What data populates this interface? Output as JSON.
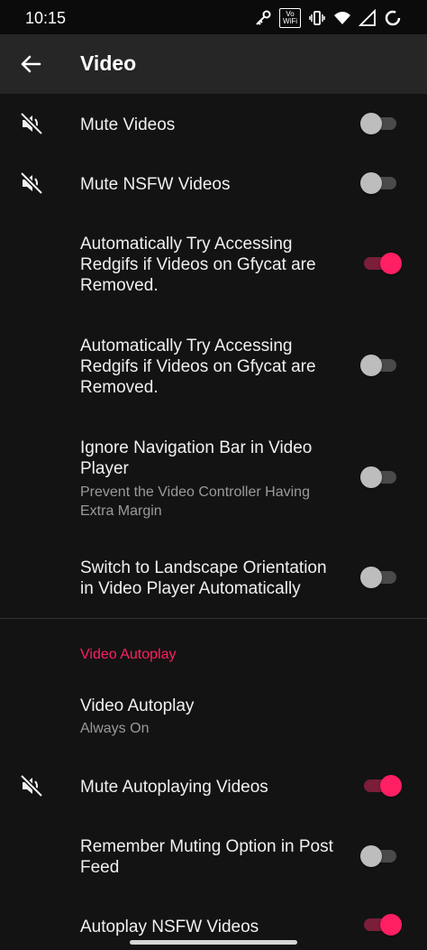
{
  "status": {
    "time": "10:15",
    "volte_top": "Vo",
    "volte_bottom": "WiFi"
  },
  "appbar": {
    "title": "Video"
  },
  "items": [
    {
      "label": "Mute Videos",
      "on": false
    },
    {
      "label": "Mute NSFW Videos",
      "on": false
    },
    {
      "label": "Automatically Try Accessing Redgifs if Videos on Gfycat are Removed.",
      "on": true
    },
    {
      "label": "Automatically Try Accessing Redgifs if Videos on Gfycat are Removed.",
      "on": false
    },
    {
      "label": "Ignore Navigation Bar in Video Player",
      "sublabel": "Prevent the Video Controller Having Extra Margin",
      "on": false
    },
    {
      "label": "Switch to Landscape Orientation in Video Player Automatically",
      "on": false
    }
  ],
  "autoplay_section": {
    "header": "Video Autoplay",
    "video_autoplay": {
      "label": "Video Autoplay",
      "sublabel": "Always On"
    },
    "items": [
      {
        "label": "Mute Autoplaying Videos",
        "on": true
      },
      {
        "label": "Remember Muting Option in Post Feed",
        "on": false
      },
      {
        "label": "Autoplay NSFW Videos",
        "on": true
      }
    ]
  },
  "colors": {
    "accent": "#ff1f63",
    "background": "#131313",
    "appbar": "#262626"
  },
  "icons": {
    "back": "arrow-left-icon",
    "mute": "volume-off-icon"
  }
}
